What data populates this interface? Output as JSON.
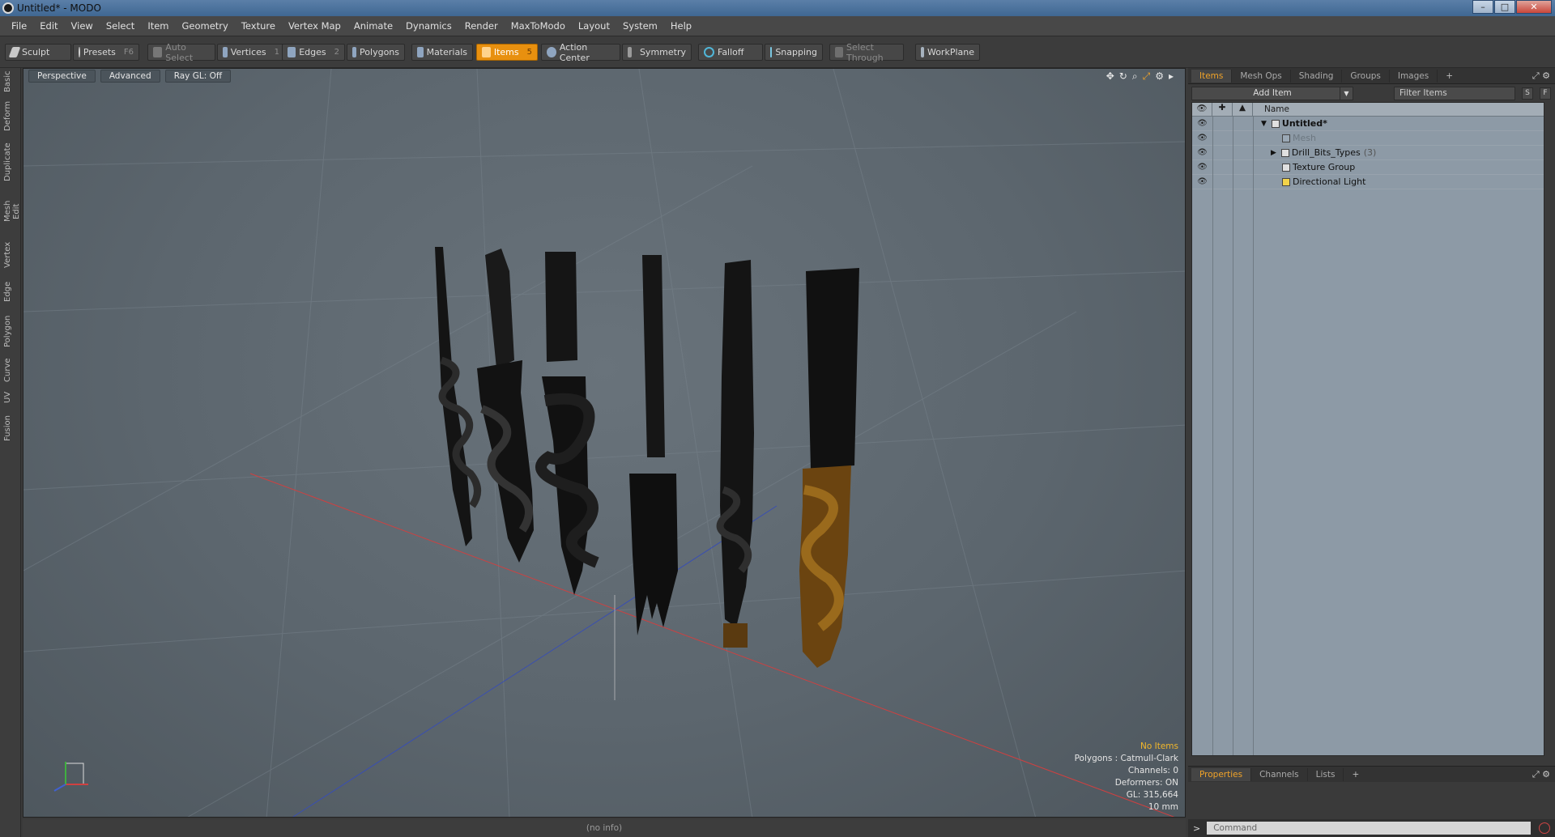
{
  "window": {
    "title": "Untitled* - MODO",
    "controls": [
      "–",
      "□",
      "✕"
    ]
  },
  "menu": [
    "File",
    "Edit",
    "View",
    "Select",
    "Item",
    "Geometry",
    "Texture",
    "Vertex Map",
    "Animate",
    "Dynamics",
    "Render",
    "MaxToModo",
    "Layout",
    "System",
    "Help"
  ],
  "toolbar": {
    "sculpt": "Sculpt",
    "presets": "Presets",
    "presets_key": "F6",
    "auto_select": "Auto Select",
    "vertices": "Vertices",
    "vertices_key": "1",
    "edges": "Edges",
    "edges_key": "2",
    "polygons": "Polygons",
    "materials": "Materials",
    "items": "Items",
    "items_key": "5",
    "action_center": "Action Center",
    "symmetry": "Symmetry",
    "falloff": "Falloff",
    "snapping": "Snapping",
    "select_through": "Select Through",
    "workplane": "WorkPlane"
  },
  "left_tabs": [
    "Basic",
    "Deform",
    "Duplicate",
    "Mesh Edit",
    "Vertex",
    "Edge",
    "Polygon",
    "Curve",
    "UV",
    "Fusion"
  ],
  "viewport": {
    "view": "Perspective",
    "shading": "Advanced",
    "raygl": "Ray GL: Off",
    "info": {
      "selection": "No Items",
      "polygons": "Polygons : Catmull-Clark",
      "channels": "Channels: 0",
      "deformers": "Deformers: ON",
      "gl": "GL: 315,664",
      "scale": "10 mm"
    }
  },
  "status": "(no info)",
  "right_panel": {
    "tabs": [
      "Items",
      "Mesh Ops",
      "Shading",
      "Groups",
      "Images",
      "+"
    ],
    "add_item": "Add Item",
    "filter_placeholder": "Filter Items",
    "btn_s": "S",
    "btn_f": "F",
    "tree_header": "Name",
    "tree": [
      {
        "label": "Untitled*",
        "count": ""
      },
      {
        "label": "Mesh",
        "count": ""
      },
      {
        "label": "Drill_Bits_Types",
        "count": "(3)"
      },
      {
        "label": "Texture Group",
        "count": ""
      },
      {
        "label": "Directional Light",
        "count": ""
      }
    ],
    "bottom_tabs": [
      "Properties",
      "Channels",
      "Lists",
      "+"
    ],
    "command_placeholder": "Command",
    "command_prompt": ">"
  },
  "colors": {
    "accent": "#e8900f",
    "active_tab": "#f0a329",
    "warn_text": "#f2b72b",
    "tree_bg": "#8d9aa6"
  }
}
